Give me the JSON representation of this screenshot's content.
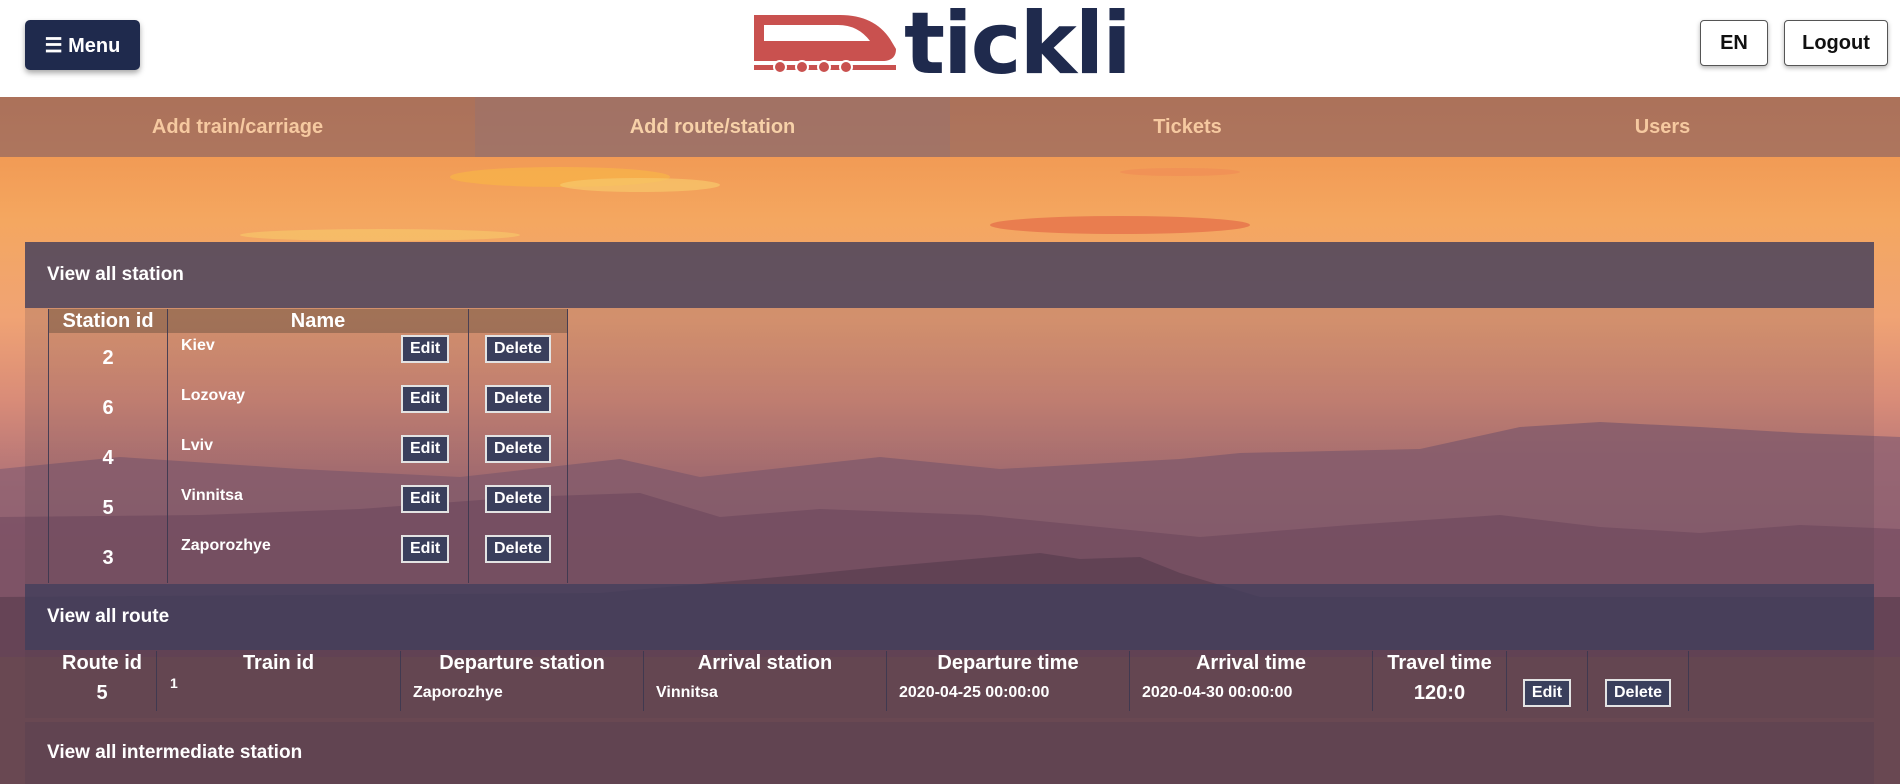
{
  "header": {
    "menu_label": "☰ Menu",
    "logo_text": "tickli",
    "lang_label": "EN",
    "logout_label": "Logout"
  },
  "nav": {
    "items": [
      {
        "label": "Add train/carriage"
      },
      {
        "label": "Add route/station"
      },
      {
        "label": "Tickets"
      },
      {
        "label": "Users"
      }
    ]
  },
  "stations": {
    "title": "View all station",
    "columns": [
      "Station id",
      "Name"
    ],
    "edit_label": "Edit",
    "delete_label": "Delete",
    "rows": [
      {
        "id": "2",
        "name": "Kiev"
      },
      {
        "id": "6",
        "name": "Lozovay"
      },
      {
        "id": "4",
        "name": "Lviv"
      },
      {
        "id": "5",
        "name": "Vinnitsa"
      },
      {
        "id": "3",
        "name": "Zaporozhye"
      }
    ]
  },
  "routes": {
    "title": "View all route",
    "columns": [
      "Route id",
      "Train id",
      "Departure station",
      "Arrival station",
      "Departure time",
      "Arrival time",
      "Travel time"
    ],
    "edit_label": "Edit",
    "delete_label": "Delete",
    "rows": [
      {
        "route_id": "5",
        "train_id": "1",
        "departure_station": "Zaporozhye",
        "arrival_station": "Vinnitsa",
        "departure_time": "2020-04-25 00:00:00",
        "arrival_time": "2020-04-30 00:00:00",
        "travel_time": "120:0"
      }
    ]
  },
  "intermediate": {
    "title": "View all intermediate station"
  },
  "colors": {
    "brand_navy": "#1f2a4d",
    "logo_red": "#c9514f",
    "nav_text": "#f6c9a0"
  }
}
